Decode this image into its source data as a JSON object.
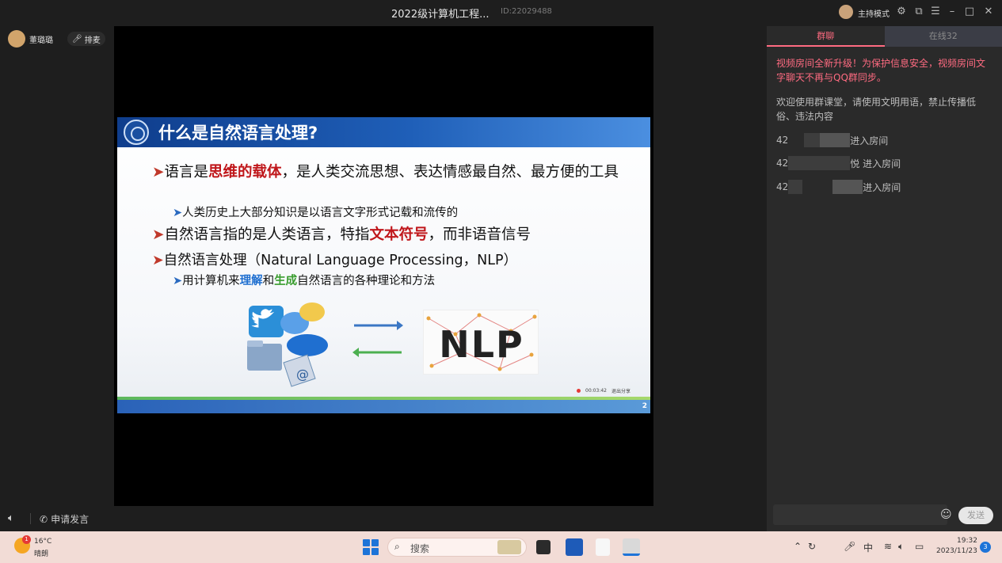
{
  "window": {
    "title": "2022级计算机工程...",
    "room_id": "ID:22029488",
    "host_mode_label": "主持模式",
    "controls": [
      "gear-icon",
      "popout-icon",
      "menu-icon",
      "minimize-icon",
      "maximize-icon",
      "close-icon"
    ]
  },
  "left": {
    "user_name": "董璐璐",
    "mic_queue_label": "排麦",
    "apply_speak_label": "申请发言"
  },
  "slide": {
    "title": "什么是自然语言处理?",
    "bullet1_prefix": "语言是",
    "bullet1_highlight": "思维的载体",
    "bullet1_suffix": "，是人类交流思想、表达情感最自然、最方便的工具",
    "bullet2": "人类历史上大部分知识是以语言文字形式记载和流传的",
    "bullet3_prefix": "自然语言指的是人类语言，特指",
    "bullet3_highlight": "文本符号",
    "bullet3_suffix": "，而非语音信号",
    "bullet4": "自然语言处理（Natural Language Processing，NLP）",
    "bullet5_prefix": "用计算机来",
    "bullet5_hl1": "理解",
    "bullet5_mid": "和",
    "bullet5_hl2": "生成",
    "bullet5_suffix": "自然语言的各种理论和方法",
    "nlp_label": "NLP",
    "rec_time": "00:03:42",
    "rec_exit": "退出分享",
    "page_number": "2"
  },
  "chat": {
    "tab_chat": "群聊",
    "tab_online": "在线32",
    "notice_red": "视频房间全新升级！为保护信息安全，视频房间文字聊天不再与QQ群同步。",
    "notice_gray": "欢迎使用群课堂，请使用文明用语，禁止传播低俗、违法内容",
    "rows": [
      {
        "prefix": "42",
        "suffix": "进入房间"
      },
      {
        "prefix": "42",
        "suffix": "悦 进入房间"
      },
      {
        "prefix": "42",
        "suffix": "进入房间"
      }
    ],
    "send_label": "发送"
  },
  "taskbar": {
    "weather_badge": "1",
    "temperature": "16°C",
    "condition": "晴朗",
    "search_label": "搜索",
    "tray_ime": "中",
    "time": "19:32",
    "date": "2023/11/23",
    "notification_count": "3"
  }
}
